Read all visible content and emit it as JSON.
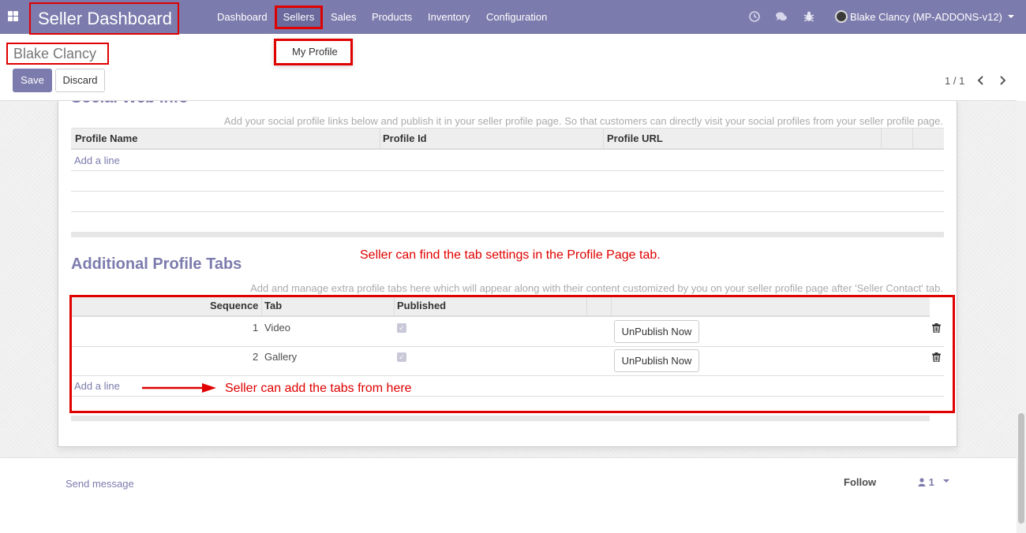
{
  "navbar": {
    "brand": "Seller Dashboard",
    "menu": [
      "Dashboard",
      "Sellers",
      "Sales",
      "Products",
      "Inventory",
      "Configuration"
    ],
    "user": "Blake Clancy (MP-ADDONS-v12)",
    "icons": [
      "apps-icon",
      "clock-icon",
      "chat-icon",
      "bug-icon",
      "avatar"
    ]
  },
  "dropdown": {
    "item": "My Profile"
  },
  "control_panel": {
    "title": "Blake Clancy",
    "save_label": "Save",
    "discard_label": "Discard",
    "pager": "1 / 1"
  },
  "social": {
    "title": "Social Web Info",
    "helper": "Add your social profile links below and publish it in your seller profile page. So that customers can directly visit your social profiles from your seller profile page.",
    "columns": [
      "Profile Name",
      "Profile Id",
      "Profile URL"
    ],
    "add_line": "Add a line"
  },
  "tabs": {
    "title": "Additional Profile Tabs",
    "helper": "Add and manage extra profile tabs here which will appear along with their content customized by you on your seller profile page after 'Seller Contact' tab.",
    "columns": [
      "Sequence",
      "Tab",
      "Published"
    ],
    "rows": [
      {
        "sequence": "1",
        "tab": "Video",
        "published": true,
        "action": "UnPublish Now"
      },
      {
        "sequence": "2",
        "tab": "Gallery",
        "published": true,
        "action": "UnPublish Now"
      }
    ],
    "add_line": "Add a line"
  },
  "annotations": {
    "note1": "Seller can find the tab settings in the Profile Page tab.",
    "note2": "Seller can add the tabs from here",
    "color": "#e00000"
  },
  "chatter": {
    "send_message": "Send message",
    "follow": "Follow",
    "followers_count": "1"
  },
  "colors": {
    "primary": "#7c7bad",
    "annotation": "#e00000"
  }
}
